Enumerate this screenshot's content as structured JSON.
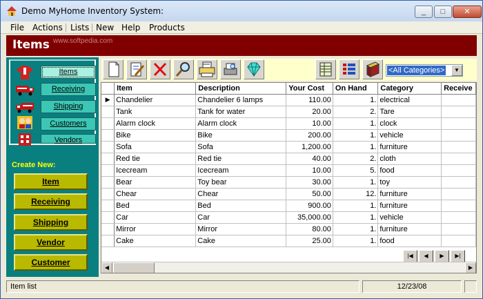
{
  "window": {
    "title": "Demo MyHome Inventory System:",
    "buttons": {
      "minimize": "_",
      "maximize": "□",
      "close": "✕"
    }
  },
  "menu": [
    "File",
    "Actions",
    "Lists",
    "New",
    "Help",
    "Products"
  ],
  "banner": {
    "title": "Items",
    "watermark": "www.softpedia.com"
  },
  "nav": {
    "items": [
      {
        "label": "Items",
        "icon": "shirt-icon"
      },
      {
        "label": "Receiving",
        "icon": "truck-icon"
      },
      {
        "label": "Shipping",
        "icon": "truck-icon"
      },
      {
        "label": "Customers",
        "icon": "people-icon"
      },
      {
        "label": "Vendors",
        "icon": "building-icon"
      }
    ]
  },
  "create": {
    "label": "Create New:",
    "buttons": [
      "Item",
      "Receiving",
      "Shipping",
      "Vendor",
      "Customer"
    ]
  },
  "toolbar": {
    "category": "<All Categories>",
    "buttons": [
      "new-document-icon",
      "edit-icon",
      "delete-icon",
      "search-icon",
      "print-icon",
      "preview-icon",
      "diamond-icon",
      "spreadsheet-icon",
      "list-icon",
      "book-icon"
    ]
  },
  "table": {
    "columns": [
      "Item",
      "Description",
      "Your Cost",
      "On Hand",
      "Category",
      "Receive"
    ],
    "rows": [
      [
        "Chandelier",
        "Chandelier 6 lamps",
        "110.00",
        "1.",
        "electrical"
      ],
      [
        "Tank",
        "Tank for water",
        "20.00",
        "2.",
        "Tare"
      ],
      [
        "Alarm clock",
        "Alarm clock",
        "10.00",
        "1.",
        "clock"
      ],
      [
        "Bike",
        "Bike",
        "200.00",
        "1.",
        "vehicle"
      ],
      [
        "Sofa",
        "Sofa",
        "1,200.00",
        "1.",
        "furniture"
      ],
      [
        "Red tie",
        "Red tie",
        "40.00",
        "2.",
        "cloth"
      ],
      [
        "Icecream",
        "Icecream",
        "10.00",
        "5.",
        "food"
      ],
      [
        "Bear",
        "Toy bear",
        "30.00",
        "1.",
        "toy"
      ],
      [
        "Chear",
        "Chear",
        "50.00",
        "12.",
        "furniture"
      ],
      [
        "Bed",
        "Bed",
        "900.00",
        "1.",
        "furniture"
      ],
      [
        "Car",
        "Car",
        "35,000.00",
        "1.",
        "vehicle"
      ],
      [
        "Mirror",
        "Mirror",
        "80.00",
        "1.",
        "furniture"
      ],
      [
        "Cake",
        "Cake",
        "25.00",
        "1.",
        "food"
      ]
    ]
  },
  "status": {
    "left": "Item list",
    "date": "12/23/08"
  },
  "colors": {
    "banner": "#800000",
    "panel": "#0a7f7f",
    "create_button": "#b9b900",
    "toolbar": "#ffffcc"
  }
}
